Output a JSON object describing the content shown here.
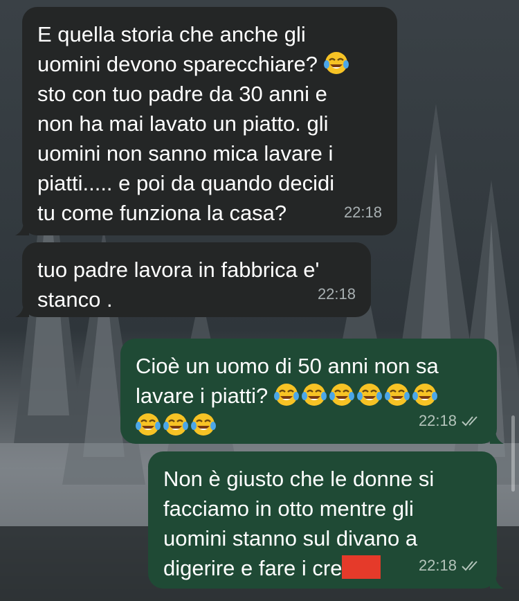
{
  "chat": {
    "messages": [
      {
        "direction": "incoming",
        "text": "E quella storia che anche gli\nuomini devono sparecchiare? ",
        "emoji_after": 1,
        "text2": "\nsto con tuo padre da 30 anni e\nnon ha mai lavato un piatto. gli\nuomini non sanno mica lavare i\npiatti..... e poi da quando decidi\ntu come funziona la casa?",
        "time": "22:18"
      },
      {
        "direction": "incoming",
        "text": "tuo padre lavora in fabbrica e'\nstanco .",
        "time": "22:18"
      },
      {
        "direction": "outgoing",
        "text": "Cioè un uomo di 50 anni non sa\nlavare i piatti? ",
        "emoji_line1": 6,
        "emoji_line2": 3,
        "time": "22:18",
        "status": "read-double-check"
      },
      {
        "direction": "outgoing",
        "text": "Non è giusto che le donne si\nfacciamo in otto mentre gli\nuomini stanno sul divano a\ndigerire e fare i cre",
        "redacted": true,
        "time": "22:18",
        "status": "read-double-check"
      }
    ],
    "emoji_name": "face-with-tears-of-joy-emoji",
    "colors": {
      "incoming_bubble": "#242626",
      "outgoing_bubble": "#1f4a35",
      "redaction": "#e53a2a"
    }
  }
}
